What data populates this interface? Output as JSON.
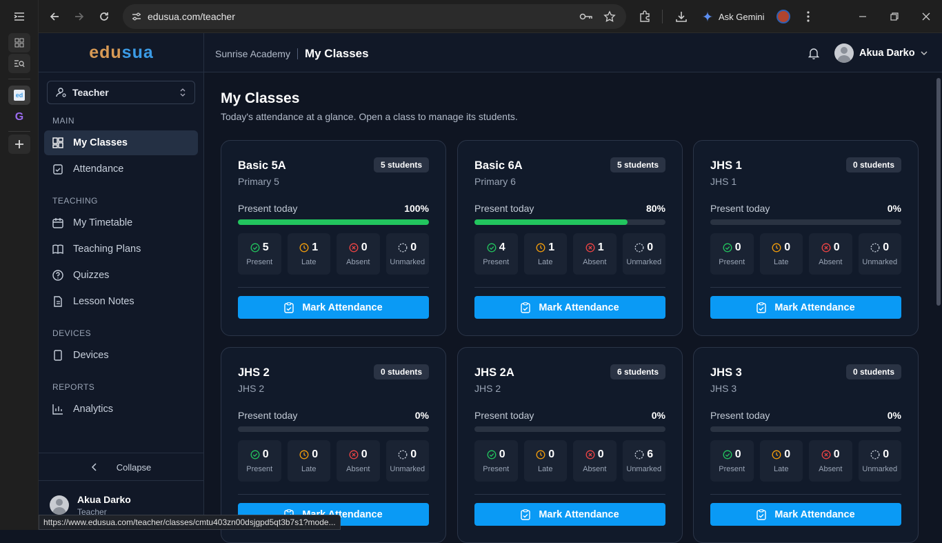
{
  "browser": {
    "url": "edusua.com/teacher",
    "ask_gemini": "Ask Gemini",
    "status_url": "https://www.edusua.com/teacher/classes/cmtu403zn00dsjgpd5qt3b7s1?mode..."
  },
  "app": {
    "logo_prefix": "edu",
    "logo_suffix": "sua",
    "brand_colors": {
      "accent": "#0a9af5",
      "logo_orange": "#d89a55",
      "logo_blue": "#3b9be6",
      "present_green": "#22c55e"
    }
  },
  "sidebar": {
    "role": "Teacher",
    "sections": {
      "main": "MAIN",
      "teaching": "TEACHING",
      "devices": "DEVICES",
      "reports": "REPORTS"
    },
    "items": {
      "my_classes": "My Classes",
      "attendance": "Attendance",
      "timetable": "My Timetable",
      "plans": "Teaching Plans",
      "quizzes": "Quizzes",
      "notes": "Lesson Notes",
      "devices": "Devices",
      "analytics": "Analytics"
    },
    "collapse": "Collapse",
    "user_name": "Akua Darko",
    "user_role": "Teacher"
  },
  "header": {
    "school": "Sunrise Academy",
    "page": "My Classes",
    "user": "Akua Darko"
  },
  "main": {
    "title": "My Classes",
    "subtitle": "Today's attendance at a glance. Open a class to manage its students."
  },
  "labels": {
    "present_today": "Present today",
    "present": "Present",
    "late": "Late",
    "absent": "Absent",
    "unmarked": "Unmarked",
    "mark": "Mark Attendance"
  },
  "classes": [
    {
      "name": "Basic 5A",
      "level": "Primary 5",
      "students": "5 students",
      "pct": "100%",
      "ratio": 1.0,
      "present": "5",
      "late": "1",
      "absent": "0",
      "unmarked": "0"
    },
    {
      "name": "Basic 6A",
      "level": "Primary 6",
      "students": "5 students",
      "pct": "80%",
      "ratio": 0.8,
      "present": "4",
      "late": "1",
      "absent": "1",
      "unmarked": "0"
    },
    {
      "name": "JHS 1",
      "level": "JHS 1",
      "students": "0 students",
      "pct": "0%",
      "ratio": 0,
      "present": "0",
      "late": "0",
      "absent": "0",
      "unmarked": "0"
    },
    {
      "name": "JHS 2",
      "level": "JHS 2",
      "students": "0 students",
      "pct": "0%",
      "ratio": 0,
      "present": "0",
      "late": "0",
      "absent": "0",
      "unmarked": "0"
    },
    {
      "name": "JHS 2A",
      "level": "JHS 2",
      "students": "6 students",
      "pct": "0%",
      "ratio": 0,
      "present": "0",
      "late": "0",
      "absent": "0",
      "unmarked": "6"
    },
    {
      "name": "JHS 3",
      "level": "JHS 3",
      "students": "0 students",
      "pct": "0%",
      "ratio": 0,
      "present": "0",
      "late": "0",
      "absent": "0",
      "unmarked": "0"
    }
  ]
}
